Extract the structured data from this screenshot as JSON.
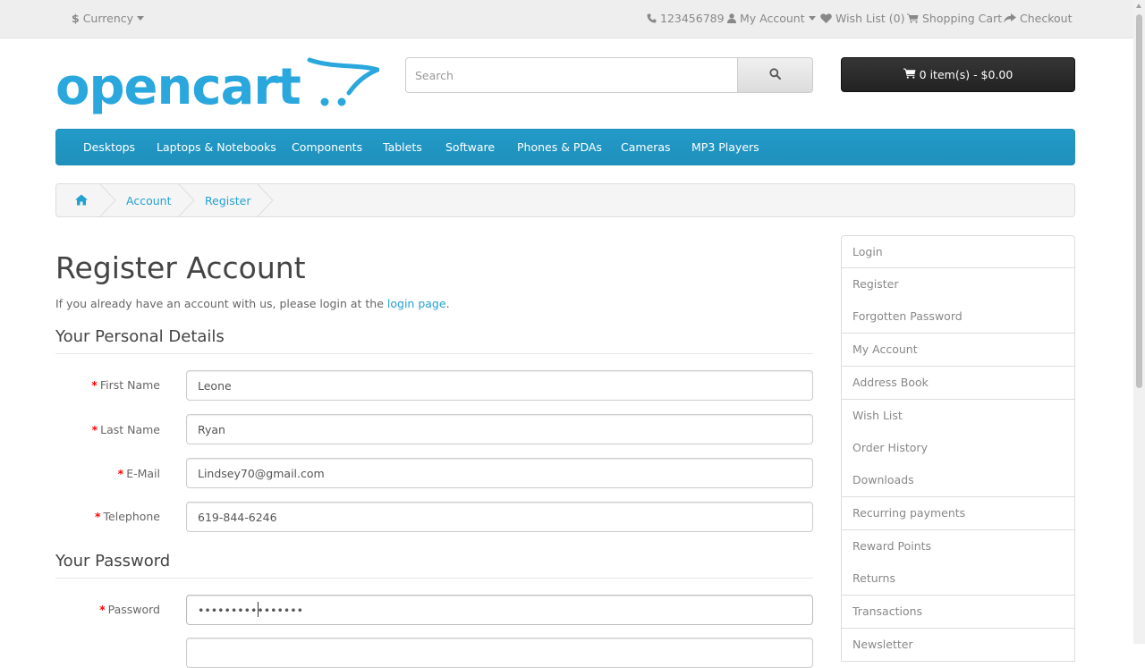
{
  "topbar": {
    "currency_label": "Currency",
    "phone": "123456789",
    "my_account": "My Account",
    "wishlist": "Wish List (0)",
    "shopping_cart": "Shopping Cart",
    "checkout": "Checkout"
  },
  "header": {
    "logo_text": "opencart",
    "search_placeholder": "Search",
    "cart_label": "0 item(s) - $0.00"
  },
  "menu": {
    "items": [
      "Desktops",
      "Laptops & Notebooks",
      "Components",
      "Tablets",
      "Software",
      "Phones & PDAs",
      "Cameras",
      "MP3 Players"
    ]
  },
  "breadcrumb": {
    "items": [
      "Account",
      "Register"
    ]
  },
  "main": {
    "title": "Register Account",
    "intro_prefix": "If you already have an account with us, please login at the",
    "intro_link": "login page",
    "intro_suffix": ".",
    "personal_legend": "Your Personal Details",
    "password_legend": "Your Password",
    "fields": {
      "firstname": {
        "label": "First Name",
        "value": "Leone"
      },
      "lastname": {
        "label": "Last Name",
        "value": "Ryan"
      },
      "email": {
        "label": "E-Mail",
        "value": "Lindsey70@gmail.com"
      },
      "telephone": {
        "label": "Telephone",
        "value": "619-844-6246"
      },
      "password": {
        "label": "Password",
        "value": "••••••••••••••••"
      }
    }
  },
  "sidebar": {
    "items": [
      "Login",
      "Register",
      "Forgotten Password",
      "My Account",
      "Address Book",
      "Wish List",
      "Order History",
      "Downloads",
      "Recurring payments",
      "Reward Points",
      "Returns",
      "Transactions",
      "Newsletter"
    ]
  },
  "colors": {
    "accent": "#23a1d1",
    "menu_bg": "#229ac8",
    "cart_bg": "#2b2b2b",
    "required": "#ff0000"
  }
}
